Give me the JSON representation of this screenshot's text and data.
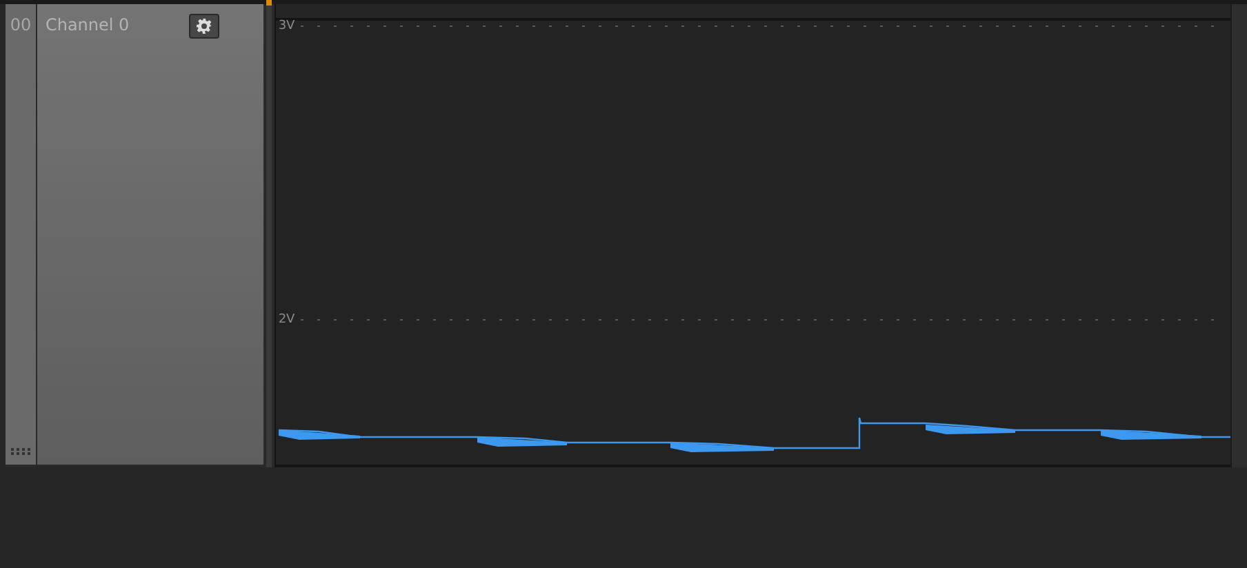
{
  "channel": {
    "index": "00",
    "name": "Channel 0"
  },
  "plot": {
    "axis_labels": [
      "3V",
      "2V"
    ]
  }
}
